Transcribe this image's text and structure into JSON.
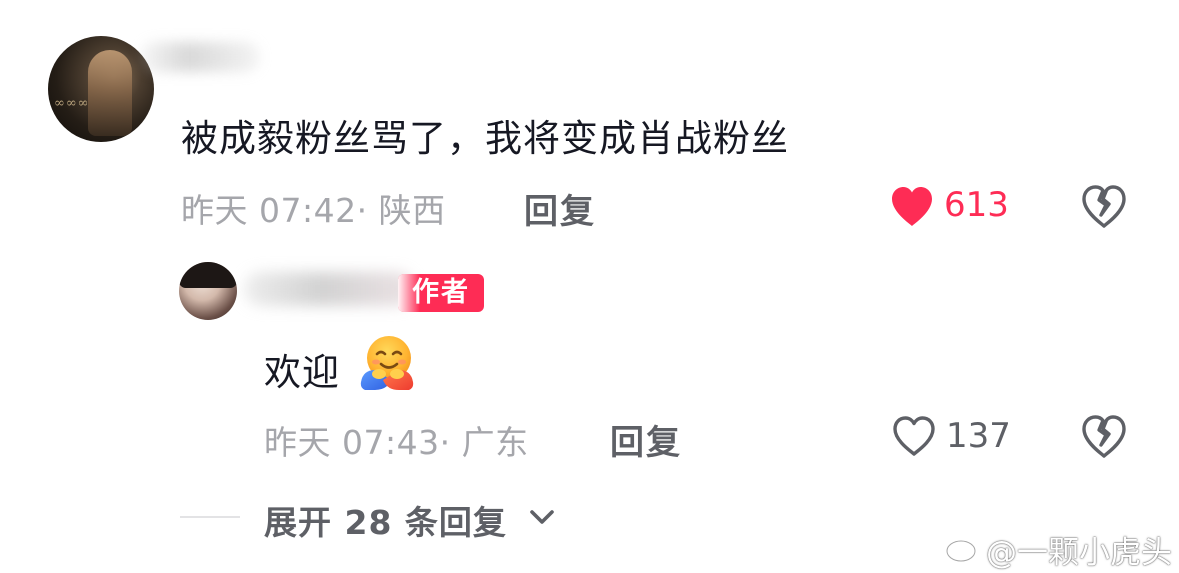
{
  "comment": {
    "text": "被成毅粉丝骂了，我将变成肖战粉丝",
    "meta": "昨天 07:42· 陕西",
    "reply_label": "回复",
    "likes": "613",
    "liked": true,
    "like_color": "#fe2c55"
  },
  "reply": {
    "badge": "作者",
    "text": "欢迎",
    "emoji": "hugging-face-emoji",
    "meta": "昨天 07:43· 广东",
    "reply_label": "回复",
    "likes": "137",
    "liked": false
  },
  "expand": {
    "label": "展开 28 条回复"
  },
  "watermark": {
    "text": "@一颗小虎头",
    "logo": "weibo-logo"
  }
}
